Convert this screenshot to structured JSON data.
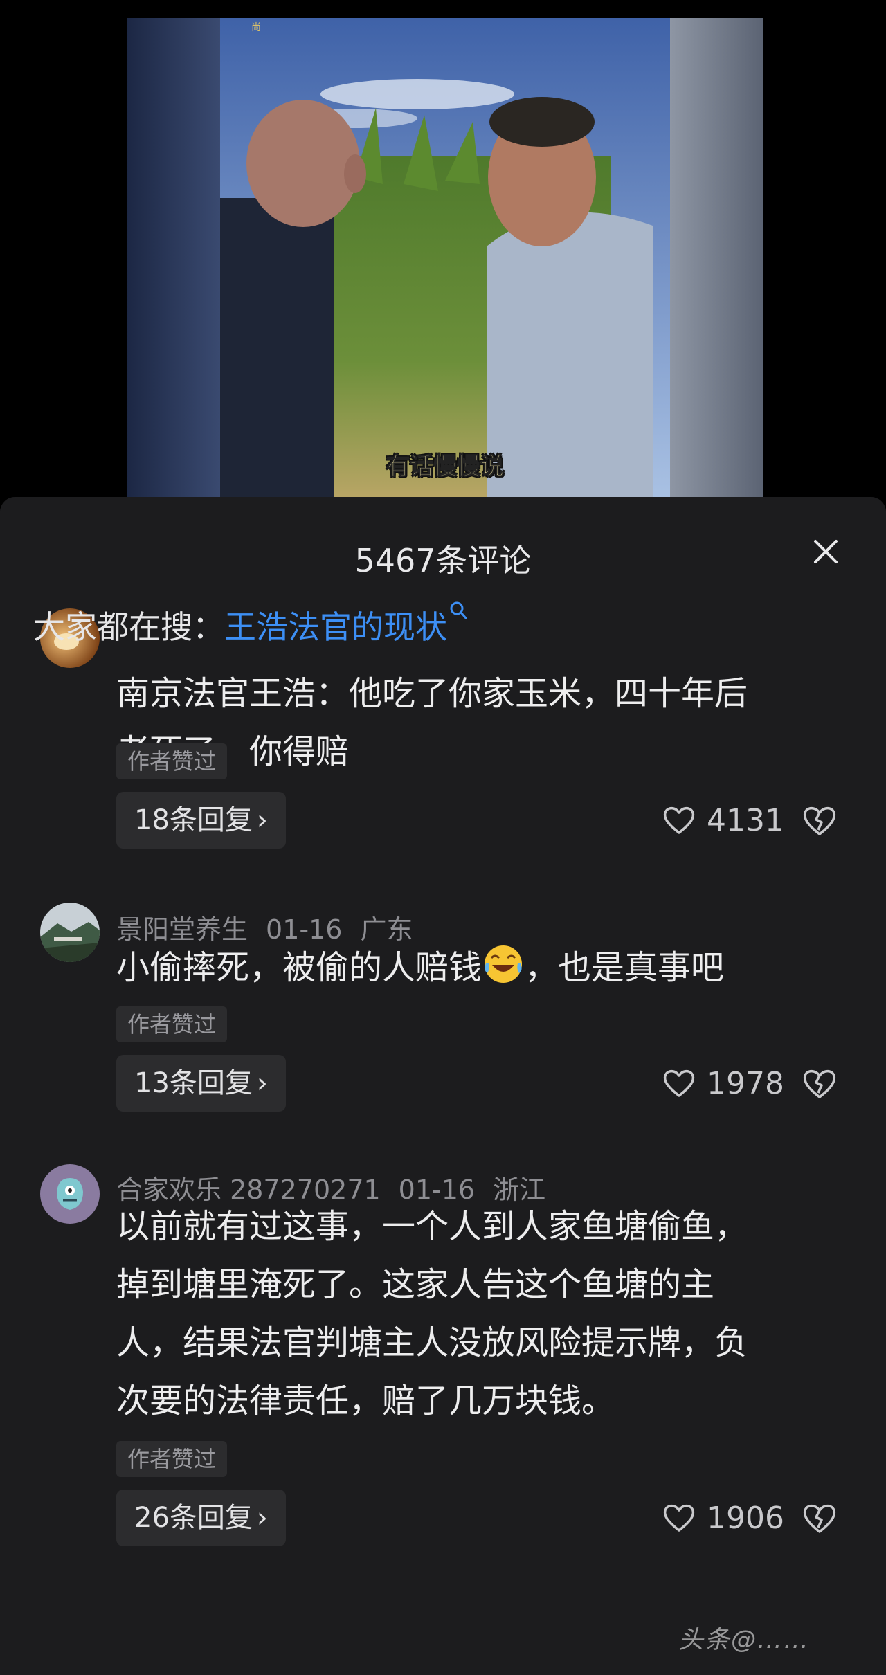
{
  "video": {
    "subtitle": "有话慢慢说",
    "corner_mark": "尚"
  },
  "comments_panel": {
    "count_title": "5467条评论",
    "close_icon": "close-icon",
    "search_prefix": "大家都在搜：",
    "search_suggestion": "王浩法官的现状",
    "search_icon": "search-icon",
    "colors": {
      "link": "#3d8ff5",
      "background": "#1c1c1e",
      "chip": "#2c2c2e"
    }
  },
  "comments": [
    {
      "user": "",
      "date": "",
      "location": "",
      "text_lines": [
        "南京法官王浩：他吃了你家玉米，四十年后",
        "老死了，你得赔"
      ],
      "badge": "作者赞过",
      "replies": "18条回复",
      "likes": "4131"
    },
    {
      "user": "景阳堂养生",
      "date": "01-16",
      "location": "广东",
      "text_before_emoji": "小偷摔死，被偷的人赔钱",
      "emoji": "laughing-crying-emoji",
      "text_after_emoji": "，也是真事吧",
      "badge": "作者赞过",
      "replies": "13条回复",
      "likes": "1978"
    },
    {
      "user": "合家欢乐 287270271",
      "date": "01-16",
      "location": "浙江",
      "text_lines": [
        "以前就有过这事，一个人到人家鱼塘偷鱼，",
        "掉到塘里淹死了。这家人告这个鱼塘的主",
        "人，结果法官判塘主人没放风险提示牌，负",
        "次要的法律责任，赔了几万块钱。"
      ],
      "badge": "作者赞过",
      "replies": "26条回复",
      "likes": "1906"
    }
  ],
  "watermark": "头条@……"
}
